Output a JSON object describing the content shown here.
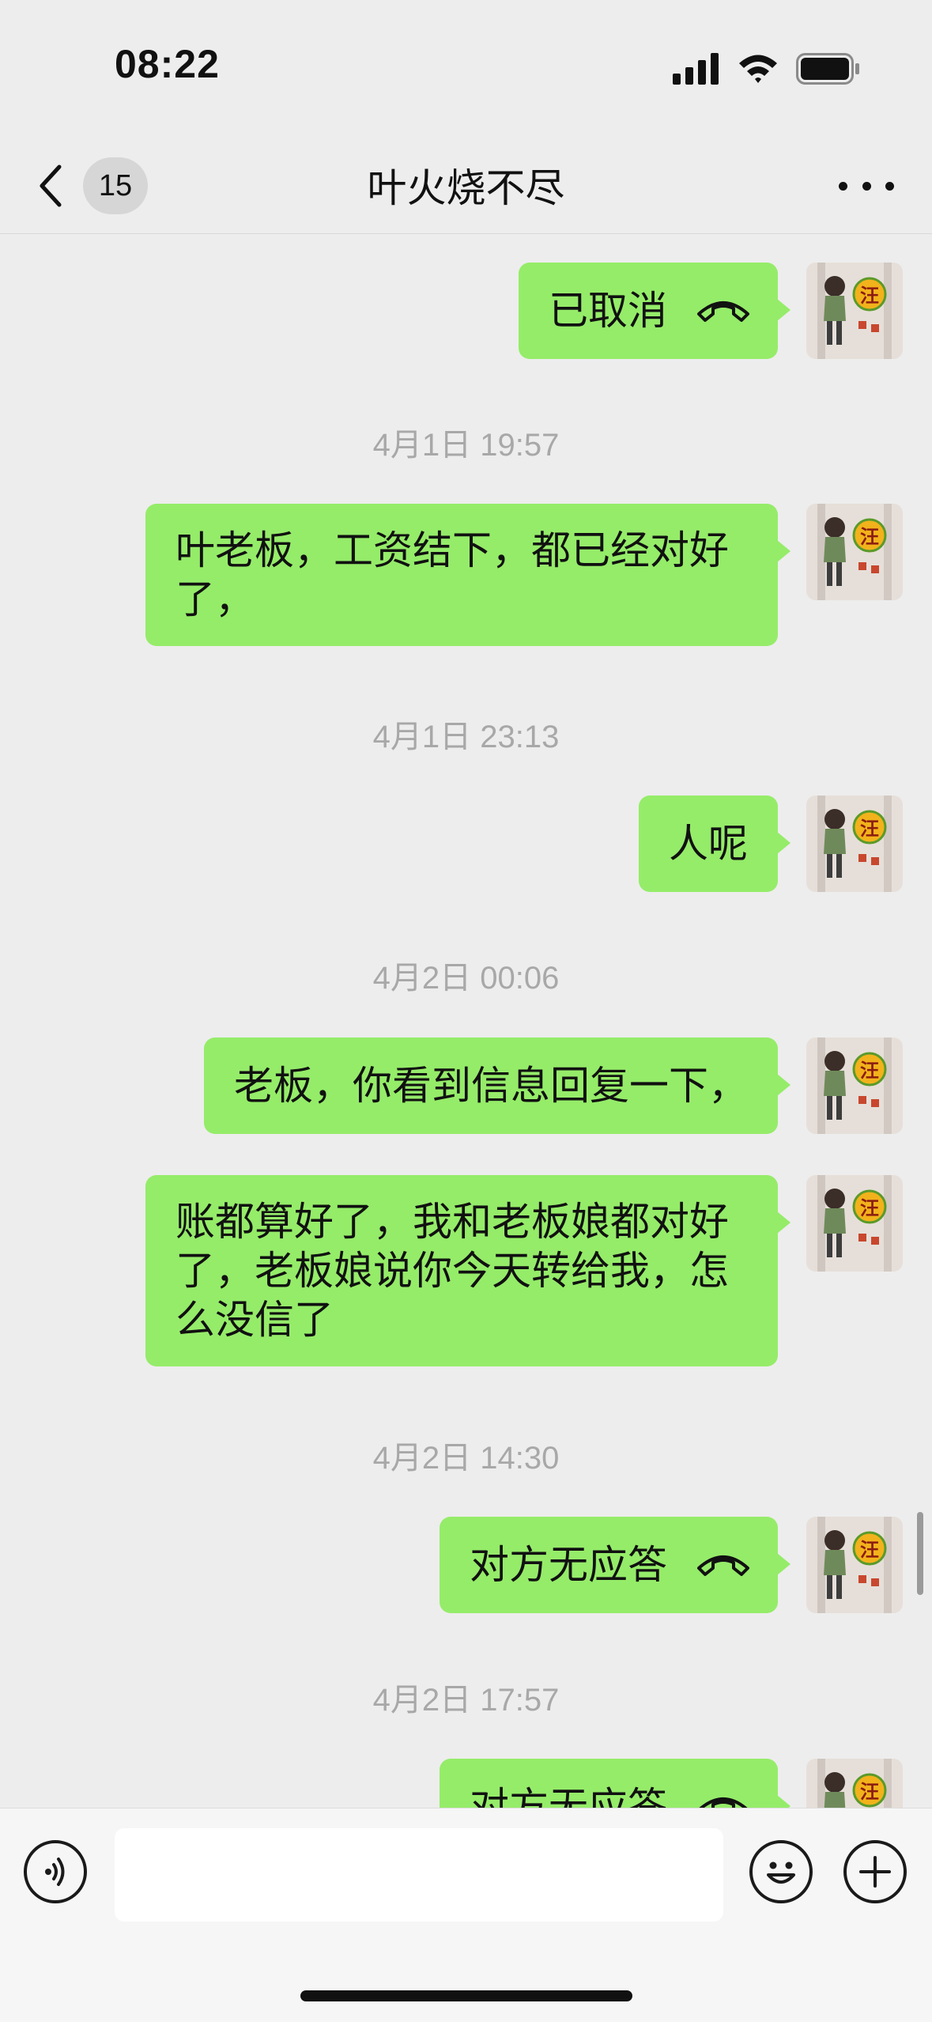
{
  "status_bar": {
    "time": "08:22"
  },
  "nav": {
    "unread_count": "15",
    "title": "叶火烧不尽"
  },
  "messages": [
    {
      "type": "call",
      "text": "已取消"
    },
    {
      "type": "timestamp",
      "text": "4月1日 19:57"
    },
    {
      "type": "text",
      "lines": [
        "叶老板，工资结下，都已经对好",
        "了，"
      ]
    },
    {
      "type": "timestamp",
      "text": "4月1日 23:13"
    },
    {
      "type": "text",
      "lines": [
        "人呢"
      ]
    },
    {
      "type": "timestamp",
      "text": "4月2日 00:06"
    },
    {
      "type": "text",
      "lines": [
        "老板，你看到信息回复一下，"
      ]
    },
    {
      "type": "text",
      "lines": [
        "账都算好了，我和老板娘都对好",
        "了，老板娘说你今天转给我，怎",
        "么没信了"
      ]
    },
    {
      "type": "timestamp",
      "text": "4月2日 14:30"
    },
    {
      "type": "call",
      "text": "对方无应答"
    },
    {
      "type": "timestamp",
      "text": "4月2日 17:57"
    },
    {
      "type": "call",
      "text": "对方无应答"
    }
  ],
  "avatar": {
    "badge_char": "汪"
  },
  "input": {
    "value": ""
  },
  "colors": {
    "bubble": "#95ec69",
    "background": "#ededed",
    "timestamp": "#a8a8a8"
  }
}
